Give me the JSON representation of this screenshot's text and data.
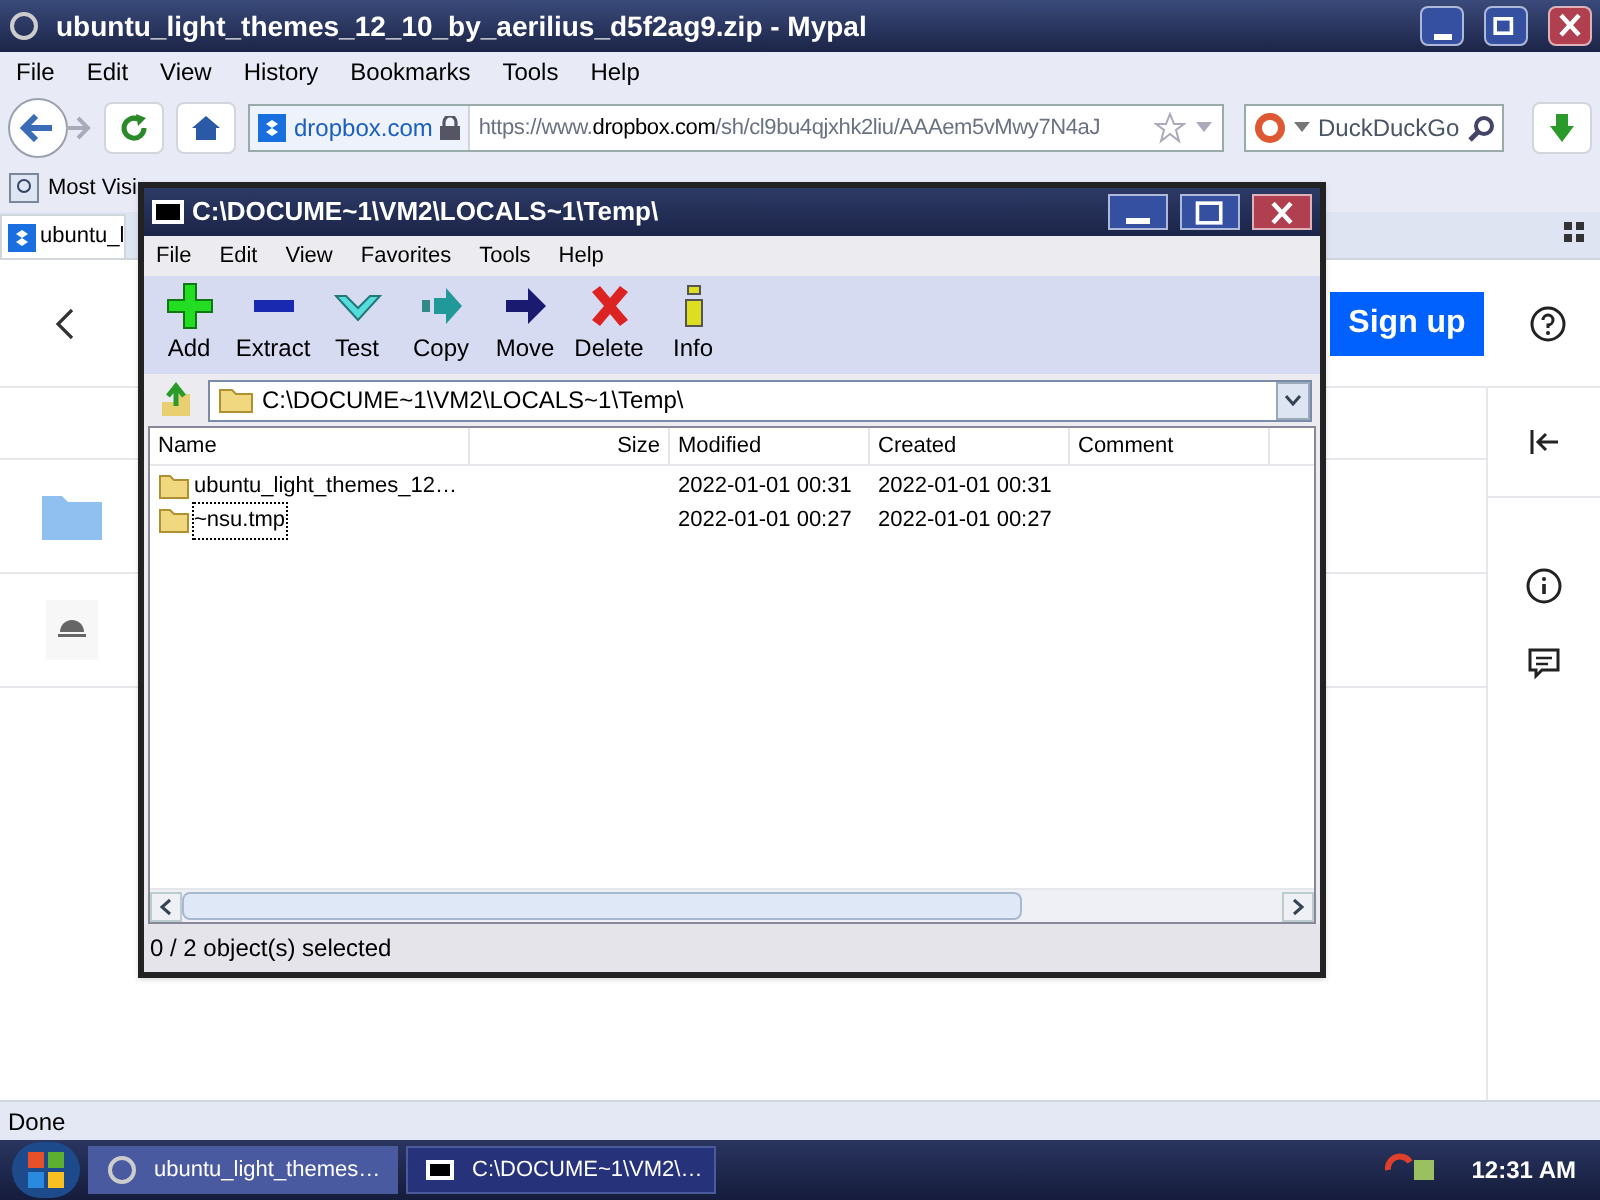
{
  "browser": {
    "title": "ubuntu_light_themes_12_10_by_aerilius_d5f2ag9.zip - Mypal",
    "menu": [
      "File",
      "Edit",
      "View",
      "History",
      "Bookmarks",
      "Tools",
      "Help"
    ],
    "site_label": "dropbox.com",
    "url_prefix": "https://www.",
    "url_domain": "dropbox.com",
    "url_rest": "/sh/cl9bu4qjxhk2liu/AAAem5vMwy7N4aJ",
    "search_placeholder": "DuckDuckGo",
    "bookmark": "Most Visi",
    "tab": "ubuntu_l",
    "status": "Done"
  },
  "page": {
    "signup": "Sign up"
  },
  "archiver": {
    "title": "C:\\DOCUME~1\\VM2\\LOCALS~1\\Temp\\",
    "menu": [
      "File",
      "Edit",
      "View",
      "Favorites",
      "Tools",
      "Help"
    ],
    "tools": [
      {
        "kind": "add",
        "label": "Add"
      },
      {
        "kind": "extract",
        "label": "Extract"
      },
      {
        "kind": "test",
        "label": "Test"
      },
      {
        "kind": "copy",
        "label": "Copy"
      },
      {
        "kind": "move",
        "label": "Move"
      },
      {
        "kind": "delete",
        "label": "Delete"
      },
      {
        "kind": "info",
        "label": "Info"
      }
    ],
    "path": "C:\\DOCUME~1\\VM2\\LOCALS~1\\Temp\\",
    "columns": [
      "Name",
      "Size",
      "Modified",
      "Created",
      "Comment"
    ],
    "rows": [
      {
        "name": "ubuntu_light_themes_12…",
        "modified": "2022-01-01 00:31",
        "created": "2022-01-01 00:31",
        "focused": false
      },
      {
        "name": "~nsu.tmp",
        "modified": "2022-01-01 00:27",
        "created": "2022-01-01 00:27",
        "focused": true
      }
    ],
    "status": "0 / 2 object(s) selected"
  },
  "taskbar": {
    "tasks": [
      {
        "kind": "browser",
        "label": "ubuntu_light_themes…",
        "selected": false
      },
      {
        "kind": "archiver",
        "label": "C:\\DOCUME~1\\VM2\\…",
        "selected": true
      }
    ],
    "clock": "12:31 AM"
  }
}
